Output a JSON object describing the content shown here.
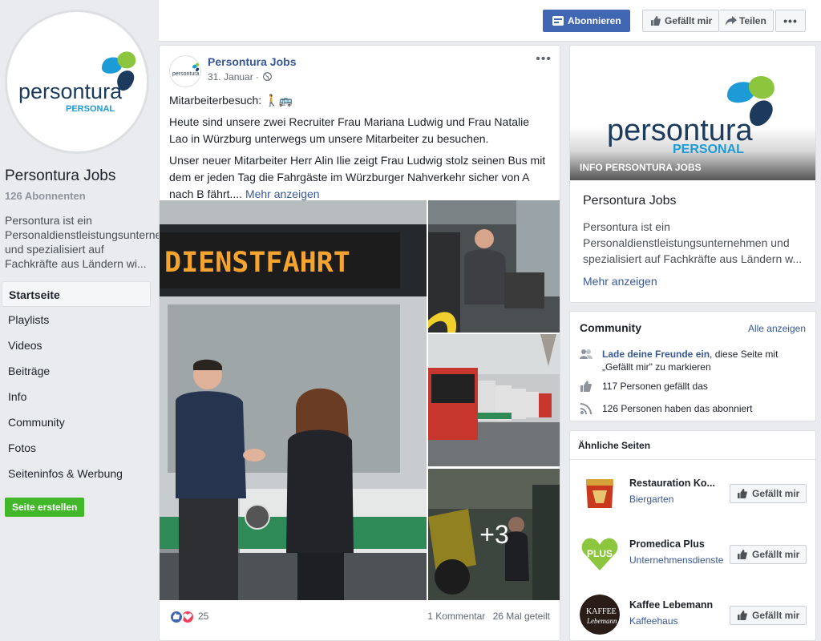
{
  "page": {
    "name": "Persontura Jobs",
    "subscribers": "126 Abonnenten",
    "description": "Persontura ist ein Personaldienstleistungsunternehmen und spezialisiert auf Fachkräfte aus Ländern wi...",
    "logo_word": "persontura",
    "logo_sub": "PERSONAL"
  },
  "nav": {
    "items": [
      {
        "label": "Startseite",
        "active": true
      },
      {
        "label": "Playlists"
      },
      {
        "label": "Videos"
      },
      {
        "label": "Beiträge"
      },
      {
        "label": "Info"
      },
      {
        "label": "Community"
      },
      {
        "label": "Fotos"
      },
      {
        "label": "Seiteninfos & Werbung"
      }
    ],
    "create_page": "Seite erstellen"
  },
  "topbar": {
    "subscribe": "Abonnieren",
    "like": "Gefällt mir",
    "share": "Teilen",
    "more": "•••"
  },
  "post": {
    "author": "Persontura Jobs",
    "date": "31. Januar ·",
    "menu": "•••",
    "line1": "Mitarbeiterbesuch: 🚶🚌",
    "line2": "Heute sind unsere zwei Recruiter Frau Mariana Ludwig und Frau Natalie Lao in Würzburg unterwegs um unsere Mitarbeiter zu besuchen.",
    "line3": "Unser neuer Mitarbeiter Herr Alin Ilie zeigt Frau Ludwig stolz seinen Bus mit dem er jeden Tag die Fahrgäste im Würzburger Nahverkehr sicher von A nach B fährt.... ",
    "more_link": "Mehr anzeigen",
    "bus_display": "DIENSTFAHRT",
    "more_photos": "+3",
    "reaction_count": "25",
    "comments": "1 Kommentar",
    "shares": "26 Mal geteilt"
  },
  "info_card": {
    "banner_label": "INFO PERSONTURA JOBS",
    "title": "Persontura Jobs",
    "text": "Persontura ist ein Personaldienstleistungsunternehmen und spezialisiert auf Fachkräfte aus Ländern w...",
    "more": "Mehr anzeigen"
  },
  "community": {
    "title": "Community",
    "see_all": "Alle anzeigen",
    "invite_link": "Lade deine Freunde ein",
    "invite_rest": ", diese Seite mit „Gefällt mir\" zu markieren",
    "likes": "117 Personen gefällt das",
    "follows": "126 Personen haben das abonniert"
  },
  "similar": {
    "title": "Ähnliche Seiten",
    "like_label": "Gefällt mir",
    "pages": [
      {
        "name": "Restauration Ko...",
        "category": "Biergarten"
      },
      {
        "name": "Promedica Plus",
        "category": "Unternehmensdienste"
      },
      {
        "name": "Kaffee Lebemann",
        "category": "Kaffeehaus"
      }
    ]
  },
  "colors": {
    "fb_blue": "#4267b2",
    "link": "#385898",
    "green": "#42b72a",
    "logo_green": "#8cc63f",
    "logo_teal": "#1d9bd7",
    "logo_navy": "#1b3a5c"
  }
}
